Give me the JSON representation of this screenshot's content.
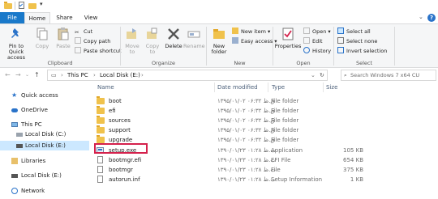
{
  "titlebar": {
    "quick_access_dropdown": "▾"
  },
  "ribbon_tabs": {
    "file": "File",
    "home": "Home",
    "share": "Share",
    "view": "View",
    "help": "?"
  },
  "clipboard": {
    "pin": "Pin to Quick access",
    "copy": "Copy",
    "paste": "Paste",
    "cut": "Cut",
    "copy_path": "Copy path",
    "paste_shortcut": "Paste shortcut",
    "label": "Clipboard"
  },
  "organize": {
    "move_to": "Move to",
    "copy_to": "Copy to",
    "delete": "Delete",
    "rename": "Rename",
    "label": "Organize"
  },
  "new_group": {
    "new_folder": "New folder",
    "new_item": "New item",
    "easy_access": "Easy access",
    "label": "New"
  },
  "open_group": {
    "properties": "Properties",
    "open": "Open",
    "edit": "Edit",
    "history": "History",
    "label": "Open"
  },
  "select_group": {
    "select_all": "Select all",
    "select_none": "Select none",
    "invert_selection": "Invert selection",
    "label": "Select"
  },
  "address": {
    "this_pc": "This PC",
    "drive": "Local Disk (E:)",
    "sep": "›",
    "search_placeholder": "Search Windows 7 x64 CU"
  },
  "nav_pane": {
    "quick_access": "Quick access",
    "onedrive": "OneDrive",
    "this_pc": "This PC",
    "local_c": "Local Disk (C:)",
    "local_e": "Local Disk (E:)",
    "libraries": "Libraries",
    "local_e2": "Local Disk (E:)",
    "network": "Network"
  },
  "columns": {
    "name": "Name",
    "date": "Date modified",
    "type": "Type",
    "size": "Size"
  },
  "files": [
    {
      "name": "boot",
      "date": "۱۳۹۵/۰۱/۰۲ ۰۶:۳۲ ق.ظ",
      "type": "File folder",
      "size": "",
      "kind": "folder"
    },
    {
      "name": "efi",
      "date": "۱۳۹۵/۰۱/۰۲ ۰۶:۳۲ ق.ظ",
      "type": "File folder",
      "size": "",
      "kind": "folder"
    },
    {
      "name": "sources",
      "date": "۱۳۹۵/۰۱/۰۲ ۰۶:۳۲ ق.ظ",
      "type": "File folder",
      "size": "",
      "kind": "folder"
    },
    {
      "name": "support",
      "date": "۱۳۹۵/۰۱/۰۲ ۰۶:۳۲ ق.ظ",
      "type": "File folder",
      "size": "",
      "kind": "folder"
    },
    {
      "name": "upgrade",
      "date": "۱۳۹۵/۰۱/۰۲ ۰۶:۳۲ ق.ظ",
      "type": "File folder",
      "size": "",
      "kind": "folder"
    },
    {
      "name": "setup.exe",
      "date": "۱۳۹۰/۰۱/۲۳ ۰۱:۲۸ ب.ظ",
      "type": "Application",
      "size": "105 KB",
      "kind": "exe"
    },
    {
      "name": "bootmgr.efi",
      "date": "۱۳۹۰/۰۱/۲۳ ۰۱:۲۸ ب.ظ",
      "type": "EFI File",
      "size": "654 KB",
      "kind": "file"
    },
    {
      "name": "bootmgr",
      "date": "۱۳۹۰/۰۱/۲۳ ۰۱:۲۸ ب.ظ",
      "type": "File",
      "size": "375 KB",
      "kind": "file"
    },
    {
      "name": "autorun.inf",
      "date": "۱۳۹۰/۰۱/۲۳ ۰۱:۲۸ ب.ظ",
      "type": "Setup Information",
      "size": "1 KB",
      "kind": "file"
    }
  ]
}
